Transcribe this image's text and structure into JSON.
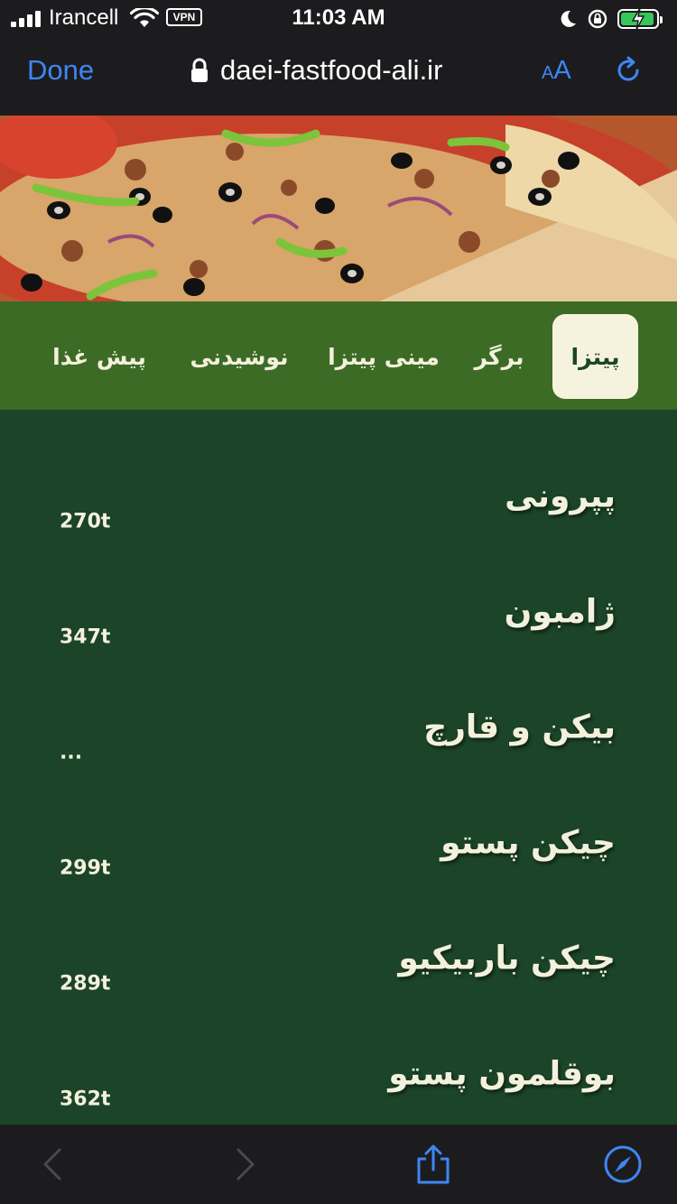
{
  "status": {
    "carrier": "Irancell",
    "vpn": "VPN",
    "time": "11:03 AM"
  },
  "browser": {
    "done_label": "Done",
    "url": "daei-fastfood-ali.ir",
    "text_size_small": "A",
    "text_size_big": "A"
  },
  "tabs": [
    {
      "label": "پیتزا",
      "active": true
    },
    {
      "label": "برگر",
      "active": false
    },
    {
      "label": "مینی پیتزا",
      "active": false
    },
    {
      "label": "نوشیدنی",
      "active": false
    },
    {
      "label": "پیش غذا",
      "active": false
    }
  ],
  "menu": [
    {
      "name": "پپرونی",
      "price": "270t"
    },
    {
      "name": "ژامبون",
      "price": "347t"
    },
    {
      "name": "بیکن و قارچ",
      "price": "..."
    },
    {
      "name": "چیکن پستو",
      "price": "299t"
    },
    {
      "name": "چیکن باربیکیو",
      "price": "289t"
    },
    {
      "name": "بوقلمون پستو",
      "price": "362t"
    }
  ],
  "colors": {
    "menu_bg": "#1b4428",
    "tabs_bg": "#3c6b25",
    "active_tab_bg": "#f5f3de",
    "text_cream": "#f3f1dc",
    "ios_blue": "#3f86f5"
  }
}
